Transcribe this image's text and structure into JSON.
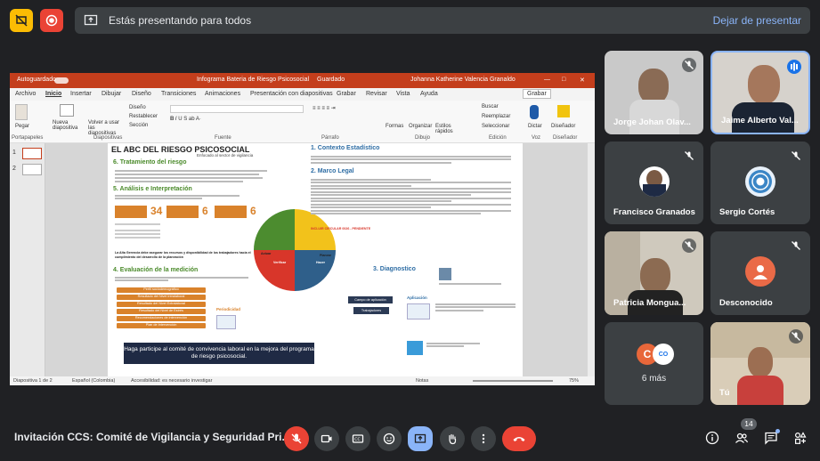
{
  "presentation_bar": {
    "status_text": "Estás presentando para todos",
    "stop_label": "Dejar de presentar"
  },
  "powerpoint": {
    "autosave_label": "Autoguardado",
    "document_title": "Infograma Bateria de Riesgo Psicosocial",
    "saved_state": "Guardado",
    "user_name": "Johanna Katherine Valencia Granaldo",
    "menu": [
      "Archivo",
      "Inicio",
      "Insertar",
      "Dibujar",
      "Diseño",
      "Transiciones",
      "Animaciones",
      "Presentación con diapositivas",
      "Grabar",
      "Revisar",
      "Vista",
      "Ayuda"
    ],
    "record_label": "Grabar",
    "ribbon": {
      "paste": "Pegar",
      "new_slide": "Nueva diapositiva",
      "reuse_slides": "Volver a usar las diapositivas",
      "design": "Diseño",
      "reset": "Restablecer",
      "section": "Sección",
      "shapes": "Formas",
      "arrange": "Organizar",
      "quick_styles": "Estilos rápidos",
      "search": "Buscar",
      "replace": "Reemplazar",
      "select": "Seleccionar",
      "dictate": "Dictar",
      "designer": "Diseñador",
      "groups": [
        "Portapapeles",
        "Diapositivas",
        "Fuente",
        "Párrafo",
        "Dibujo",
        "Edición",
        "Voz",
        "Diseñador"
      ]
    },
    "thumbnails": [
      "1",
      "2"
    ],
    "status": {
      "slide_of": "Diapositiva 1 de 2",
      "language": "Español (Colombia)",
      "accessibility": "Accesibilidad: es necesario investigar",
      "notes": "Notas",
      "zoom": "75%"
    }
  },
  "slide": {
    "title": "EL ABC DEL RIESGO PSICOSOCIAL",
    "subtitle": "Enfocado al sector de vigilancia",
    "sections": {
      "s1": "1. Contexto Estadístico",
      "s2": "2. Marco Legal",
      "s3": "3. Diagnostico",
      "s4": "4. Evaluación de la medición",
      "s5": "5. Análisis e Interpretación",
      "s6": "6. Tratamiento del riesgo"
    },
    "pie_labels": {
      "actuar": "Actuar",
      "planear": "Planear",
      "verificar": "Verificar",
      "hacer": "Hacer"
    },
    "stat_numbers": [
      "34",
      "6",
      "6"
    ],
    "orange_items": [
      "Perfil sociodemográfico",
      "Resultado del Nivel Intralaboral",
      "Resultado del Nivel Extralaboral",
      "Resultado del Nivel de Estrés",
      "Recomendaciones de intervención",
      "Plan de Intervención"
    ],
    "diag_boxes": [
      "Campo de aplicación",
      "Trabajadores"
    ],
    "periodicidad": "Periodicidad",
    "aplicacion": "Aplicación",
    "alta_gerencia": "La Alta Gerencia debe asegurar los recursos y disponibilidad de los trabajadores hacia el cumplimiento del desarrollo de la planeación",
    "footer_banner": "Haga participe al comité de convivencia laboral en la mejora del programa de riesgo psicosocial.",
    "red_note": "INCLUIR CIRCULAR 0026 - PENDIENTE"
  },
  "participants": [
    {
      "name": "Jorge Johan Olav...",
      "muted": true
    },
    {
      "name": "Jaime Alberto Val...",
      "muted": false,
      "speaking": true
    },
    {
      "name": "Francisco Granados",
      "muted": true
    },
    {
      "name": "Sergio Cortés",
      "muted": true
    },
    {
      "name": "Patricia Mongua...",
      "muted": true
    },
    {
      "name": "Desconocido",
      "muted": true
    },
    {
      "name": "6 más"
    },
    {
      "name": "Tú",
      "muted": true
    }
  ],
  "bottom": {
    "meeting_title": "Invitación CCS: Comité de Vigilancia y Seguridad Pri...",
    "people_count": "14"
  },
  "colors": {
    "bg": "#202124",
    "end_call": "#ea4335",
    "present_active": "#8ab4f8",
    "ppt_red": "#c43e1c"
  }
}
